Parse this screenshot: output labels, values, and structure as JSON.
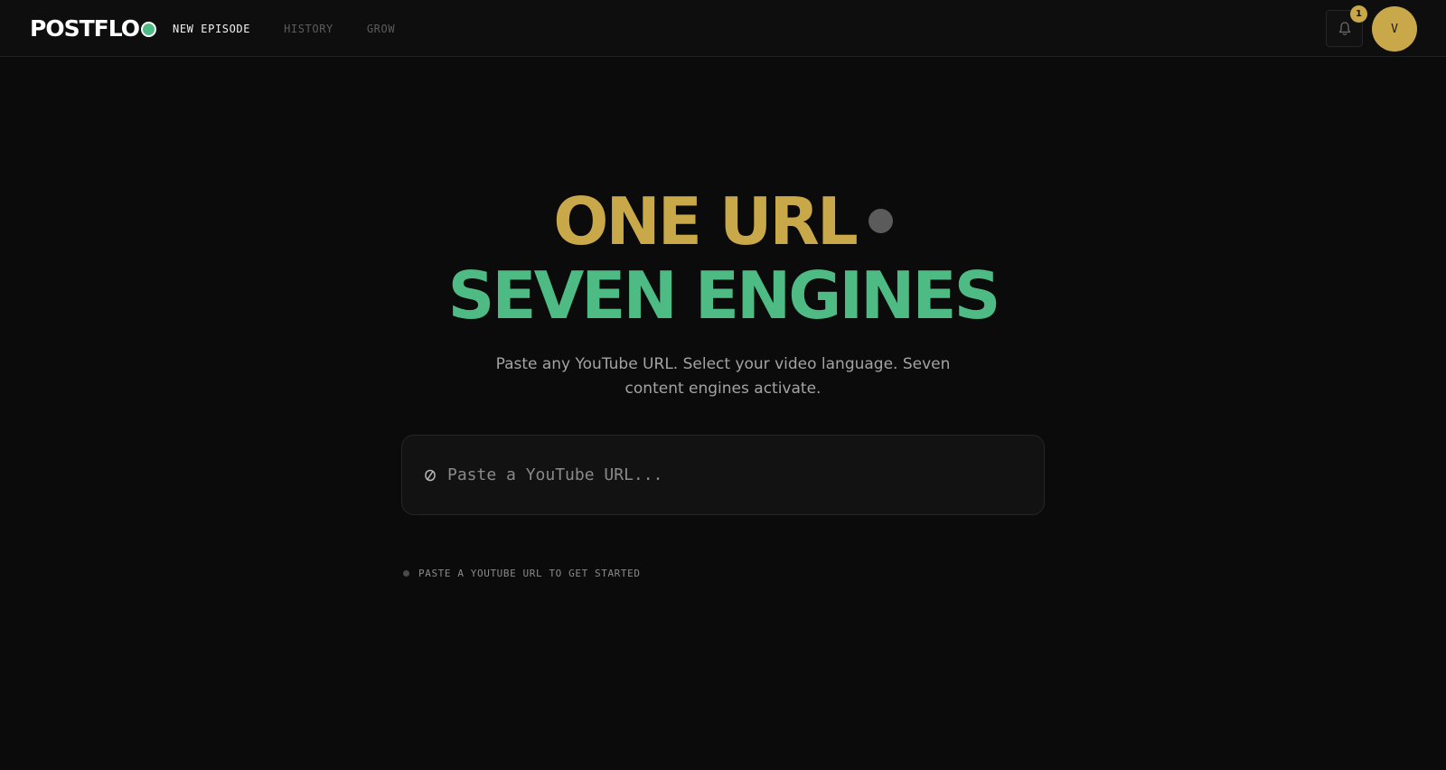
{
  "header": {
    "logo_text": "POSTFLO",
    "nav": [
      {
        "label": "NEW EPISODE",
        "active": true
      },
      {
        "label": "HISTORY",
        "active": false
      },
      {
        "label": "GROW",
        "active": false
      }
    ],
    "notification_count": "1",
    "avatar_initial": "V"
  },
  "hero": {
    "line1": "ONE URL",
    "line2": "SEVEN ENGINES",
    "subtitle": "Paste any YouTube URL. Select your video language. Seven content engines activate."
  },
  "url_input": {
    "placeholder": "Paste a YouTube URL...",
    "value": "",
    "icon": "link-icon"
  },
  "hint": {
    "text": "PASTE A YOUTUBE URL TO GET STARTED"
  },
  "colors": {
    "accent_gold": "#c9a84a",
    "accent_green": "#4dbb83",
    "background": "#0b0b0b"
  }
}
